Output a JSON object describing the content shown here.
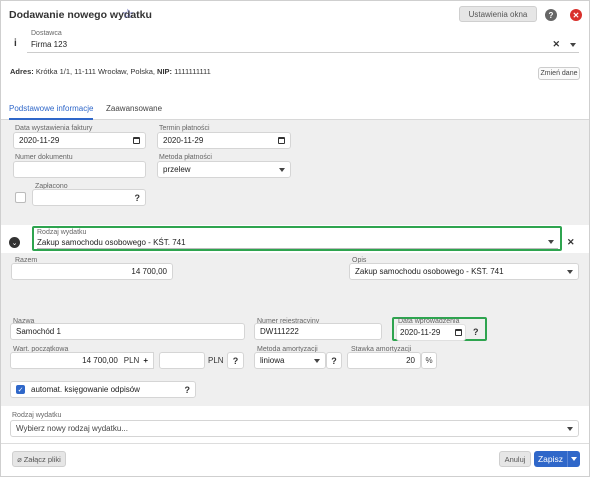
{
  "header": {
    "title": "Dodawanie nowego wydatku",
    "settings_button": "Ustawienia okna",
    "help_label": "?",
    "close_label": "✕"
  },
  "supplier": {
    "label": "Dostawca",
    "value": "Firma 123",
    "address_label": "Adres:",
    "address": "Krótka 1/1, 11-111 Wrocław, Polska,",
    "nip_label": "NIP:",
    "nip": "1111111111",
    "change_button": "Zmień dane"
  },
  "tabs": [
    {
      "label": "Podstawowe informacje",
      "active": true
    },
    {
      "label": "Zaawansowane",
      "active": false
    }
  ],
  "invoice": {
    "issue_date_label": "Data wystawienia faktury",
    "issue_date": "2020-11-29",
    "due_date_label": "Termin płatności",
    "due_date": "2020-11-29",
    "doc_number_label": "Numer dokumentu",
    "doc_number": "",
    "payment_method_label": "Metoda płatności",
    "payment_method": "przelew",
    "paid_label": "Zapłacono",
    "paid_value": ""
  },
  "expense": {
    "type_label": "Rodzaj wydatku",
    "type_value": "Zakup samochodu osobowego - KŚT. 741",
    "total_label": "Razem",
    "total": "14 700,00",
    "desc_label": "Opis",
    "desc_value": "Zakup samochodu osobowego - KŚT. 741"
  },
  "asset": {
    "name_label": "Nazwa",
    "name": "Samochód 1",
    "reg_label": "Numer rejestracyjny",
    "reg": "DW111222",
    "entry_date_label": "Data wprowadzenia",
    "entry_date": "2020-11-29",
    "initial_value_label": "Wart. początkowa",
    "initial_value": "14 700,00",
    "currency1": "PLN",
    "plus": "+",
    "extra_value": "",
    "currency2": "PLN",
    "method_label": "Metoda amortyzacji",
    "method": "liniowa",
    "rate_label": "Stawka amortyzacji",
    "rate": "20",
    "percent": "%",
    "auto_booking_label": "automat. księgowanie odpisów"
  },
  "new_expense": {
    "label": "Rodzaj wydatku",
    "placeholder": "Wybierz nowy rodzaj wydatku..."
  },
  "footer": {
    "attach_button": "Załącz pliki",
    "cancel_button": "Anuluj",
    "save_button": "Zapisz"
  },
  "colors": {
    "accent": "#2f67c9",
    "highlight_border": "#2ea44f",
    "close_red": "#d9302c"
  }
}
